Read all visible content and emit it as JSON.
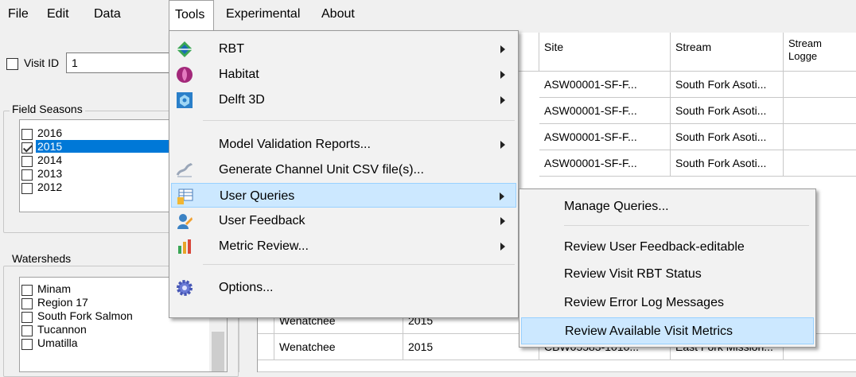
{
  "menubar": {
    "items": [
      {
        "label": "File"
      },
      {
        "label": "Edit"
      },
      {
        "label": "Data"
      },
      {
        "label": "Tools"
      },
      {
        "label": "Experimental"
      },
      {
        "label": "About"
      }
    ]
  },
  "left_panel": {
    "visit_id": {
      "label": "Visit ID",
      "value": "1",
      "checked": false
    },
    "field_seasons": {
      "title": "Field Seasons",
      "items": [
        {
          "label": "2016",
          "checked": false,
          "selected": false
        },
        {
          "label": "2015",
          "checked": true,
          "selected": true
        },
        {
          "label": "2014",
          "checked": false,
          "selected": false
        },
        {
          "label": "2013",
          "checked": false,
          "selected": false
        },
        {
          "label": "2012",
          "checked": false,
          "selected": false
        }
      ]
    },
    "watersheds": {
      "title": "Watersheds",
      "items": [
        {
          "label": "Minam",
          "checked": false
        },
        {
          "label": "Region 17",
          "checked": false
        },
        {
          "label": "South Fork Salmon",
          "checked": false
        },
        {
          "label": "Tucannon",
          "checked": false
        },
        {
          "label": "Umatilla",
          "checked": false
        }
      ]
    }
  },
  "grid": {
    "columns": [
      "Site",
      "Stream",
      "Stream Logge"
    ],
    "rows": [
      {
        "watershed": "",
        "year": "",
        "site": "ASW00001-SF-F...",
        "stream": "South Fork Asoti..."
      },
      {
        "watershed": "",
        "year": "",
        "site": "ASW00001-SF-F...",
        "stream": "South Fork Asoti..."
      },
      {
        "watershed": "",
        "year": "",
        "site": "ASW00001-SF-F...",
        "stream": "South Fork Asoti..."
      },
      {
        "watershed": "",
        "year": "",
        "site": "ASW00001-SF-F...",
        "stream": "South Fork Asoti..."
      },
      {
        "watershed": "Wenatchee",
        "year": "2015",
        "site": "",
        "stream": ""
      },
      {
        "watershed": "Wenatchee",
        "year": "2015",
        "site": "CBW05583-1010...",
        "stream": "East Fork Mission..."
      }
    ]
  },
  "tools_menu": {
    "items": [
      {
        "label": "RBT",
        "icon": "rbt-icon",
        "has_submenu": true
      },
      {
        "label": "Habitat",
        "icon": "habitat-icon",
        "has_submenu": true
      },
      {
        "label": "Delft 3D",
        "icon": "delft3d-icon",
        "has_submenu": true
      },
      {
        "label": "Model Validation Reports...",
        "icon": "",
        "has_submenu": true
      },
      {
        "label": "Generate Channel Unit CSV file(s)...",
        "icon": "channel-unit-icon",
        "has_submenu": false
      },
      {
        "label": "User Queries",
        "icon": "user-queries-icon",
        "has_submenu": true
      },
      {
        "label": "User Feedback",
        "icon": "user-feedback-icon",
        "has_submenu": true
      },
      {
        "label": "Metric Review...",
        "icon": "metric-review-icon",
        "has_submenu": true
      },
      {
        "label": "Options...",
        "icon": "options-gear-icon",
        "has_submenu": false
      }
    ]
  },
  "user_queries_submenu": {
    "items": [
      {
        "label": "Manage Queries..."
      },
      {
        "label": "Review User Feedback-editable"
      },
      {
        "label": "Review Visit RBT Status"
      },
      {
        "label": "Review Error Log Messages"
      },
      {
        "label": "Review Available Visit Metrics"
      }
    ]
  },
  "colors": {
    "selection_blue": "#0078d7",
    "menu_highlight": "#cce8ff",
    "menu_highlight_border": "#99d1ff"
  }
}
